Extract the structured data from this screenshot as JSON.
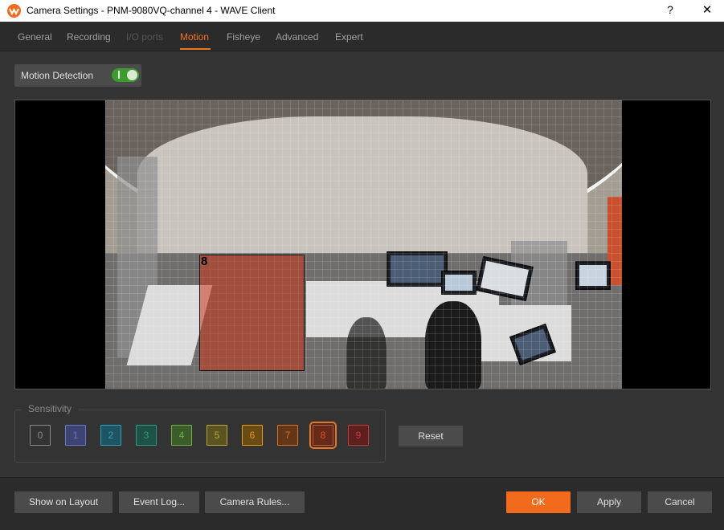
{
  "window": {
    "title": "Camera Settings - PNM-9080VQ-channel 4 - WAVE Client",
    "help_label": "?",
    "close_label": "✕"
  },
  "tabs": [
    {
      "label": "General",
      "state": "normal"
    },
    {
      "label": "Recording",
      "state": "normal"
    },
    {
      "label": "I/O ports",
      "state": "disabled"
    },
    {
      "label": "Motion",
      "state": "active"
    },
    {
      "label": "Fisheye",
      "state": "normal"
    },
    {
      "label": "Advanced",
      "state": "normal"
    },
    {
      "label": "Expert",
      "state": "normal"
    }
  ],
  "motion_detection": {
    "label": "Motion Detection",
    "enabled": true
  },
  "motion_region": {
    "sensitivity_label": "8"
  },
  "sensitivity": {
    "title": "Sensitivity",
    "selected": 8,
    "levels": [
      {
        "label": "0",
        "color": "#8a8a8a",
        "bg": "#333333"
      },
      {
        "label": "1",
        "color": "#6a77c9",
        "bg": "#3d4372"
      },
      {
        "label": "2",
        "color": "#2e9fbd",
        "bg": "#1f5563"
      },
      {
        "label": "3",
        "color": "#2c9a7e",
        "bg": "#1e5246"
      },
      {
        "label": "4",
        "color": "#6fae4a",
        "bg": "#3c5c2a"
      },
      {
        "label": "5",
        "color": "#b6a93a",
        "bg": "#5b5420"
      },
      {
        "label": "6",
        "color": "#e39a1f",
        "bg": "#6a4b12"
      },
      {
        "label": "7",
        "color": "#d6702a",
        "bg": "#633617"
      },
      {
        "label": "8",
        "color": "#d8532d",
        "bg": "#672918"
      },
      {
        "label": "9",
        "color": "#c23a38",
        "bg": "#5e1f1e"
      }
    ],
    "reset_label": "Reset"
  },
  "footer": {
    "show_on_layout": "Show on Layout",
    "event_log": "Event Log...",
    "camera_rules": "Camera Rules...",
    "ok": "OK",
    "apply": "Apply",
    "cancel": "Cancel"
  },
  "colors": {
    "accent": "#f26b1d",
    "toggle_on": "#3c9a2f"
  }
}
